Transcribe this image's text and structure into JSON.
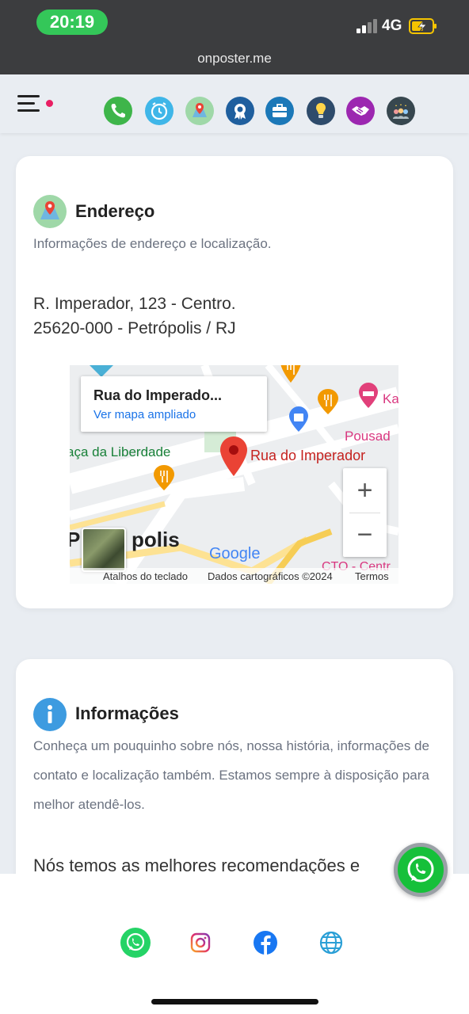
{
  "status_bar": {
    "time": "20:19",
    "network": "4G"
  },
  "browser": {
    "url": "onposter.me"
  },
  "nav": {
    "icons": [
      "phone-icon",
      "clock-icon",
      "map-icon",
      "award-icon",
      "briefcase-icon",
      "lightbulb-icon",
      "handshake-icon",
      "team-icon"
    ]
  },
  "address_section": {
    "title": "Endereço",
    "description": "Informações de endereço e localização.",
    "address_line1": "R. Imperador, 123 - Centro.",
    "address_line2": "25620-000 - Petrópolis / RJ"
  },
  "map": {
    "info_title": "Rua do Imperado...",
    "info_link": "Ver mapa ampliado",
    "pin_label": "Rua do Imperador",
    "place_label_1": "aça da Liberdade",
    "place_label_2": "Pousad",
    "place_label_3": "Ka",
    "city_label": "Petrópolis",
    "city_label_visible_start": "P",
    "city_label_visible_end": "polis",
    "cto_label": "CTO - Centr",
    "google_logo": "Google",
    "footer_shortcuts": "Atalhos do teclado",
    "footer_data": "Dados cartográficos ©2024",
    "footer_terms": "Termos",
    "zoom_in": "+",
    "zoom_out": "−"
  },
  "info_section": {
    "title": "Informações",
    "description": "Conheça um pouquinho sobre nós, nossa história, informações de contato e localização também. Estamos sempre à disposição para melhor atendê-los.",
    "subheading": "Nós temos as melhores recomendações e"
  },
  "bottom_bar": {
    "links": [
      "whatsapp-icon",
      "instagram-icon",
      "facebook-icon",
      "globe-icon"
    ]
  },
  "colors": {
    "whatsapp": "#25d366",
    "status_green": "#34c759",
    "link_blue": "#1a73e8",
    "map_pin": "#ea4335"
  }
}
